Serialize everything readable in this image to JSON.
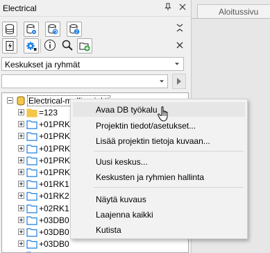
{
  "panel": {
    "title": "Electrical",
    "pin_glyph": "↓",
    "close_glyph": "×",
    "collapse_glyph": "×",
    "toolbar": [
      {
        "icon": "database-icon"
      },
      {
        "icon": "database-settings-icon"
      },
      {
        "icon": "database-sync-icon"
      },
      {
        "icon": "database-export-icon"
      },
      {
        "icon": "lightning-icon"
      },
      {
        "icon": "settings-icon"
      },
      {
        "icon": "info-icon"
      },
      {
        "icon": "search-icon"
      },
      {
        "icon": "add-folder-icon"
      }
    ],
    "filter_select": {
      "value": "Keskukset ja ryhmät"
    },
    "search": {
      "value": ""
    },
    "tree": {
      "root": {
        "label": "Electrical-malliprojekti"
      },
      "nodes": [
        {
          "label": "=123"
        },
        {
          "label": "+01PRK"
        },
        {
          "label": "+01PRK"
        },
        {
          "label": "+01PRK"
        },
        {
          "label": "+01PRK"
        },
        {
          "label": "+01PRK"
        },
        {
          "label": "+01RK1"
        },
        {
          "label": "+01RK2"
        },
        {
          "label": "+02RK1"
        },
        {
          "label": "+03DB0"
        },
        {
          "label": "+03DB0"
        },
        {
          "label": "+03DB0"
        },
        {
          "label": "+03DB04"
        }
      ]
    }
  },
  "right": {
    "tab_label": "Aloitussivu"
  },
  "context_menu": {
    "items": [
      {
        "label": "Avaa DB työkalu",
        "hover": true
      },
      {
        "label": "Projektin tiedot/asetukset..."
      },
      {
        "label": "Lisää projektin tietoja kuvaan..."
      },
      {
        "label": "Uusi keskus..."
      },
      {
        "label": "Keskusten ja ryhmien hallinta"
      },
      {
        "label": "Näytä kuvaus"
      },
      {
        "label": "Laajenna kaikki"
      },
      {
        "label": "Kutista"
      }
    ]
  },
  "colors": {
    "folder": "#f3c64b",
    "folder_blue": "#1d7fe0",
    "accent_green": "#2e9e3a"
  }
}
